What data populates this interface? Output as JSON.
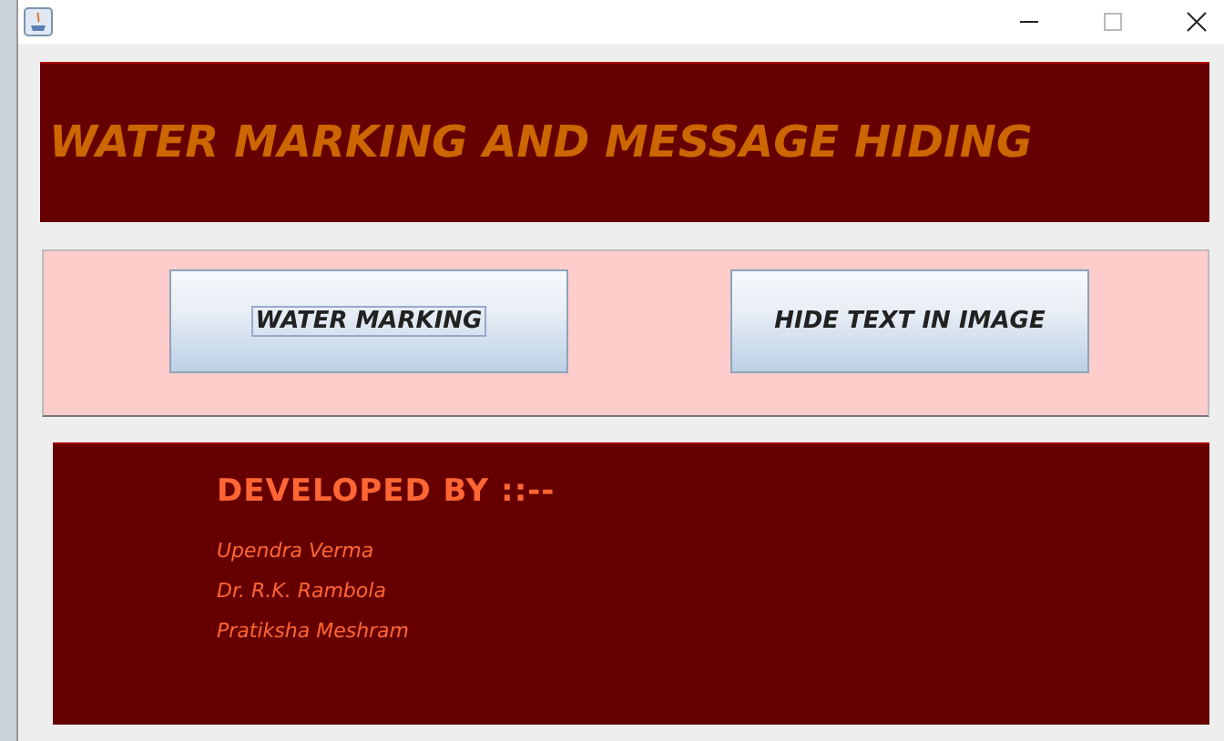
{
  "banner": {
    "title": "WATER MARKING AND MESSAGE HIDING"
  },
  "buttons": [
    {
      "label": "WATER MARKING",
      "focused": true
    },
    {
      "label": "HIDE TEXT IN IMAGE",
      "focused": false
    }
  ],
  "credits": {
    "heading": "DEVELOPED BY ::--",
    "names": [
      "Upendra Verma",
      "Dr. R.K. Rambola",
      "Pratiksha Meshram"
    ]
  }
}
